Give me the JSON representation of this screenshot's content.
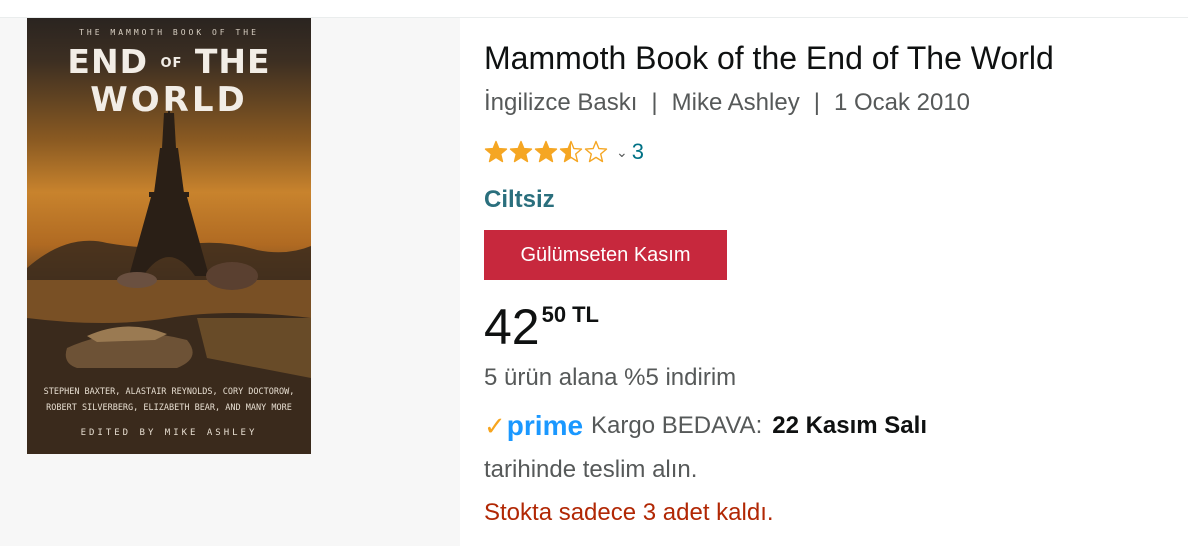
{
  "product": {
    "title": "Mammoth Book of the End of The World",
    "edition": "İngilizce Baskı",
    "author": "Mike Ashley",
    "date": "1 Ocak 2010",
    "rating": 3.5,
    "rating_max": 5,
    "rating_count": "3",
    "format": "Ciltsiz",
    "deal_badge": "Gülümseten Kasım",
    "price_whole": "42",
    "price_fraction": "50",
    "price_currency": "TL",
    "promo": "5 ürün alana %5 indirim",
    "prime_label": "prime",
    "shipping_label": "Kargo BEDAVA:",
    "delivery_date": "22 Kasım Salı",
    "delivery_suffix": "tarihinde teslim alın.",
    "stock_message": "Stokta sadece 3 adet kaldı."
  },
  "cover": {
    "top_line": "THE MAMMOTH BOOK OF THE",
    "title_end": "END",
    "title_of": "OF",
    "title_the": "THE",
    "title_world": "WORLD",
    "authors_line1": "STEPHEN BAXTER, ALASTAIR REYNOLDS, CORY DOCTOROW,",
    "authors_line2": "ROBERT SILVERBERG, ELIZABETH BEAR, AND MANY MORE",
    "editor": "EDITED BY MIKE ASHLEY"
  },
  "icons": {
    "star_full": "star-full-icon",
    "star_half": "star-half-icon",
    "star_empty": "star-empty-icon",
    "chevron": "chevron-down-icon",
    "prime_check": "prime-check-icon"
  },
  "colors": {
    "star": "#f5a623",
    "link": "#007185",
    "format": "#2a6f7d",
    "deal_badge": "#c7283d",
    "prime": "#1a98ff",
    "stock": "#b12704",
    "secondary_text": "#565959"
  }
}
